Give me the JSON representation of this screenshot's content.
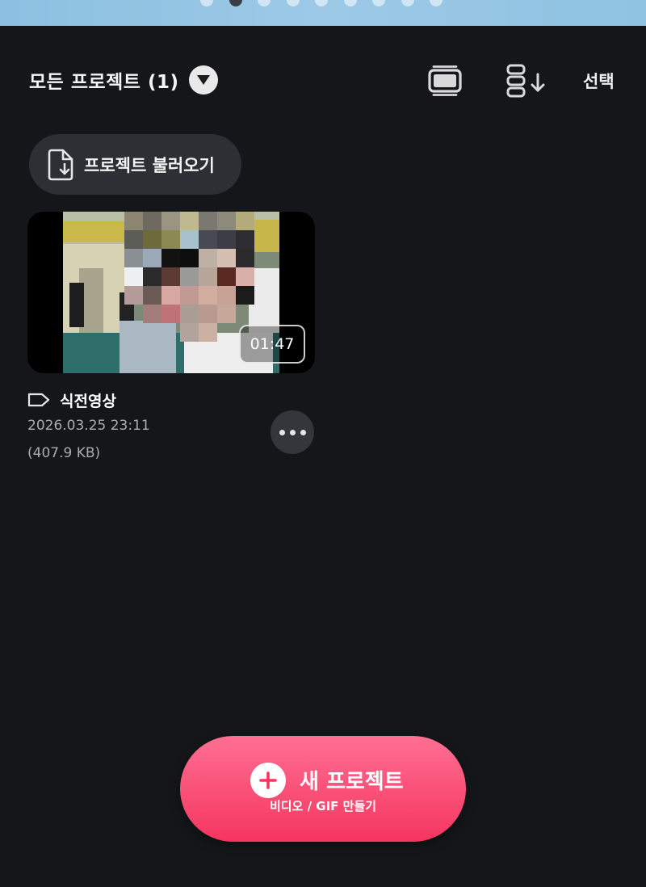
{
  "page_indicator": {
    "count": 9,
    "active_index": 1
  },
  "header": {
    "filter_title": "모든 프로젝트 (1)",
    "select_label": "선택"
  },
  "import_button": {
    "label": "프로젝트 불러오기"
  },
  "project": {
    "duration": "01:47",
    "name": "식전영상",
    "date": "2026.03.25   23:11",
    "size": "(407.9 KB)"
  },
  "new_project_button": {
    "title": "새 프로젝트",
    "subtitle": "비디오 / GIF 만들기"
  },
  "colors": {
    "background": "#141619",
    "accent_gradient_top": "#ff6f93",
    "accent_gradient_bottom": "#f5355f",
    "chip_background": "#2c2f33"
  },
  "icons": {
    "dropdown": "triangle-down-icon",
    "view_mode": "card-stack-icon",
    "sort": "sort-down-icon",
    "import": "file-import-icon",
    "tag": "label-tag-icon",
    "more": "more-horizontal-icon",
    "add": "plus-icon"
  }
}
